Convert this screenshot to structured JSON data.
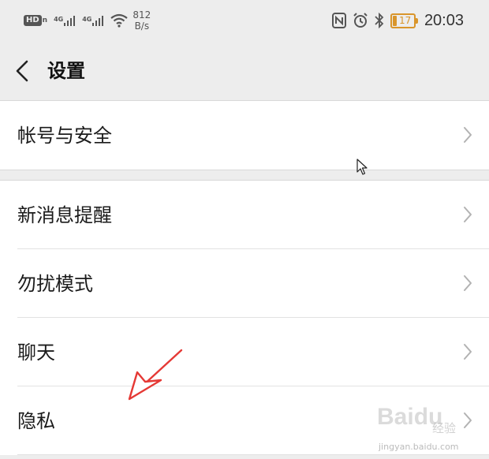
{
  "status_bar": {
    "hd_label": "HD",
    "hd_sub": "n",
    "signal1_label": "4G",
    "signal2_label": "4G",
    "speed_value": "812",
    "speed_unit": "B/s",
    "battery_level": "17",
    "time": "20:03",
    "battery_color": "#d9952b"
  },
  "nav": {
    "title": "设置"
  },
  "sections": [
    {
      "items": [
        {
          "label": "帐号与安全"
        }
      ]
    },
    {
      "items": [
        {
          "label": "新消息提醒"
        },
        {
          "label": "勿扰模式"
        },
        {
          "label": "聊天"
        },
        {
          "label": "隐私"
        }
      ]
    }
  ],
  "annotation": {
    "color": "#e53935"
  },
  "watermark": {
    "logo": "Bai",
    "logo_suffix": "du",
    "cn": "经验",
    "url": "jingyan.baidu.com"
  }
}
